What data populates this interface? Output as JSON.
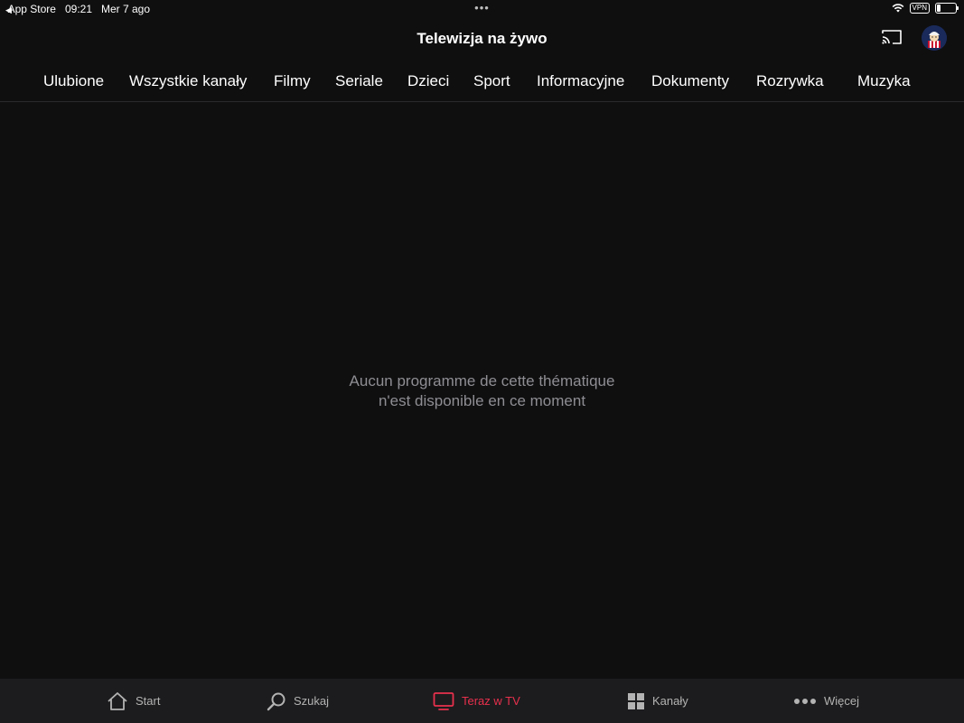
{
  "status_bar": {
    "back_app": "App Store",
    "time": "09:21",
    "date": "Mer 7 ago",
    "vpn": "VPN",
    "battery_level": 0.18
  },
  "header": {
    "title": "Telewizja na żywo"
  },
  "tabs": [
    {
      "label": "Ulubione"
    },
    {
      "label": "Wszystkie kanały"
    },
    {
      "label": "Filmy"
    },
    {
      "label": "Seriale"
    },
    {
      "label": "Dzieci"
    },
    {
      "label": "Sport"
    },
    {
      "label": "Informacyjne"
    },
    {
      "label": "Dokumenty"
    },
    {
      "label": "Rozrywka"
    },
    {
      "label": "Muzyka"
    }
  ],
  "active_tab": "Sport",
  "empty_state": {
    "line1": "Aucun programme de cette thématique",
    "line2": "n'est disponible en ce moment"
  },
  "bottom_nav": [
    {
      "label": "Start",
      "icon": "home-icon"
    },
    {
      "label": "Szukaj",
      "icon": "search-icon"
    },
    {
      "label": "Teraz w TV",
      "icon": "tv-icon"
    },
    {
      "label": "Kanały",
      "icon": "grid-icon"
    },
    {
      "label": "Więcej",
      "icon": "more-icon"
    }
  ],
  "active_nav": "Teraz w TV",
  "colors": {
    "accent": "#e8304d",
    "background": "#0f0f10",
    "bottom_bar": "#1c1c1e",
    "muted_text": "#8e8e93"
  }
}
